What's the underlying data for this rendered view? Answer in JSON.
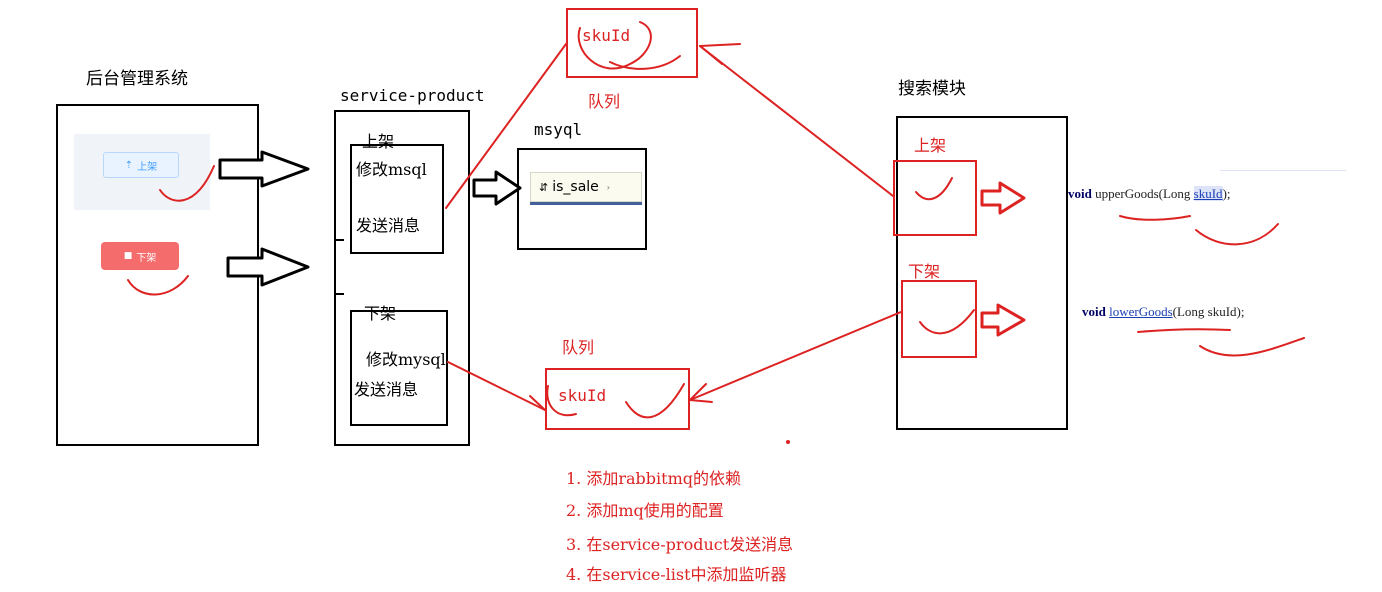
{
  "admin": {
    "title": "后台管理系统",
    "up_button": "上架",
    "down_button": "下架",
    "up_icon": "upload-icon",
    "down_icon": "trash-icon"
  },
  "service": {
    "title": "service-product",
    "up_label": "上架",
    "up_step1": "修改msql",
    "up_step2": "发送消息",
    "down_label": "下架",
    "down_step1": "修改mysql",
    "down_step2": "发送消息"
  },
  "mysql": {
    "title": "msyql",
    "field": "is_sale",
    "field_icon": "sort-icon"
  },
  "queue_top": {
    "content": "skuId",
    "label": "队列"
  },
  "queue_bottom": {
    "content": "skuId",
    "label": "队列"
  },
  "search": {
    "title": "搜索模块",
    "up_label": "上架",
    "down_label": "下架"
  },
  "code": {
    "upper_keyword": "void",
    "upper_method": "upperGoods",
    "upper_args_open": "(Long ",
    "upper_param": "skuId",
    "upper_args_close": ");",
    "lower_keyword": "void",
    "lower_method": "lowerGoods",
    "lower_args": "(Long skuId);"
  },
  "notes": [
    "1. 添加rabbitmq的依赖",
    "2. 添加mq使用的配置",
    "3. 在service-product发送消息",
    "4. 在service-list中添加监听器"
  ],
  "colors": {
    "annotation": "#dd2222",
    "box": "#000000",
    "up_button_bg": "#e8f3ff",
    "down_button_bg": "#f56c6c"
  }
}
